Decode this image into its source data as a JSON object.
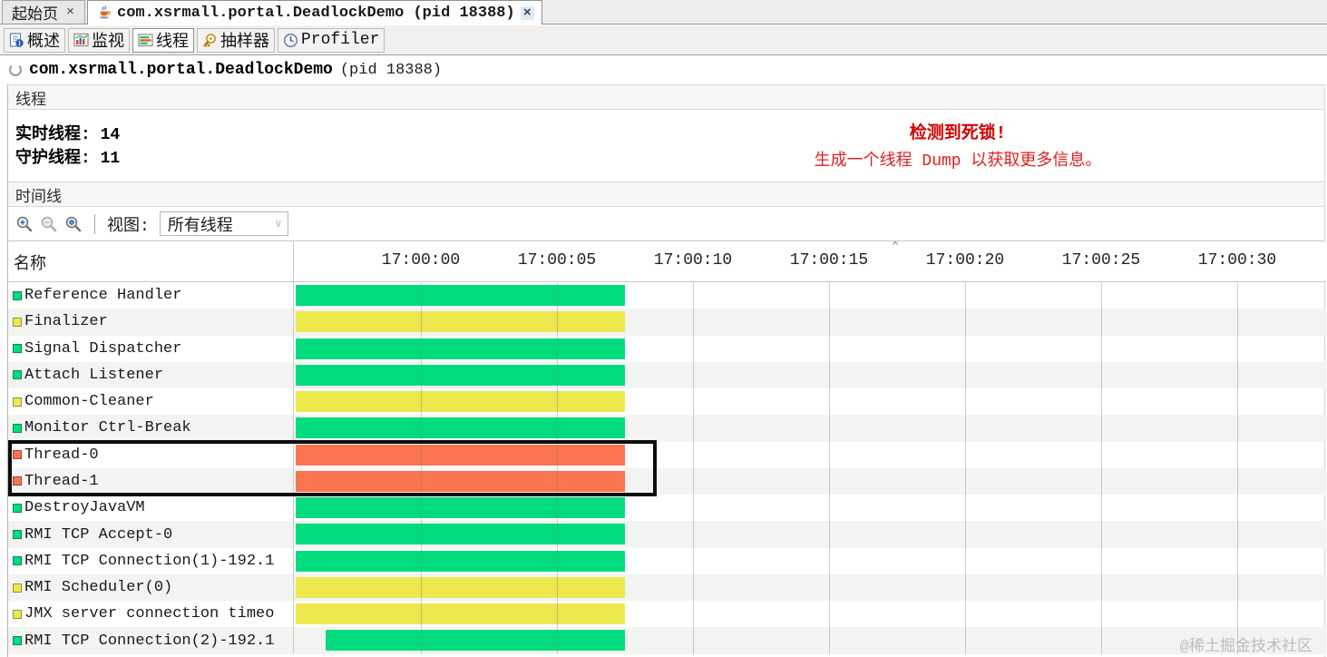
{
  "window": {
    "tabs": [
      {
        "label": "起始页",
        "icon": null,
        "active": false
      },
      {
        "label": "com.xsrmall.portal.DeadlockDemo (pid 18388)",
        "icon": "java-cup-icon",
        "active": true
      }
    ],
    "close_glyph": "×"
  },
  "toolbar": {
    "buttons": [
      {
        "label": "概述",
        "icon": "overview-icon",
        "selected": false
      },
      {
        "label": "监视",
        "icon": "monitor-icon",
        "selected": false
      },
      {
        "label": "线程",
        "icon": "threads-icon",
        "selected": true
      },
      {
        "label": "抽样器",
        "icon": "sampler-icon",
        "selected": false
      },
      {
        "label": "Profiler",
        "icon": "profiler-icon",
        "selected": false
      }
    ]
  },
  "header": {
    "app_name": "com.xsrmall.portal.DeadlockDemo",
    "pid": "(pid 18388)"
  },
  "threads_section": {
    "title": "线程",
    "live_label": "实时线程:",
    "live_value": "14",
    "daemon_label": "守护线程:",
    "daemon_value": "11",
    "deadlock_title": "检测到死锁!",
    "deadlock_message": "生成一个线程 Dump 以获取更多信息。"
  },
  "timeline_section": {
    "title": "时间线",
    "view_label": "视图:",
    "view_value": "所有线程",
    "name_column_header": "名称",
    "chevron": "∨"
  },
  "chart_data": {
    "type": "timeline",
    "x_axis": {
      "ticks": [
        "17:00:00",
        "17:00:05",
        "17:00:10",
        "17:00:15",
        "17:00:20",
        "17:00:25",
        "17:00:30"
      ],
      "tick_interval_seconds": 5
    },
    "state_colors": {
      "green": "#00DC7D",
      "yellow": "#EDE84E",
      "orange": "#FA7450"
    },
    "rows": [
      {
        "name": "Reference Handler",
        "state": "green",
        "start_s": -4.6,
        "end_s": 7.5,
        "highlighted": false
      },
      {
        "name": "Finalizer",
        "state": "yellow",
        "start_s": -4.6,
        "end_s": 7.5,
        "highlighted": false
      },
      {
        "name": "Signal Dispatcher",
        "state": "green",
        "start_s": -4.6,
        "end_s": 7.5,
        "highlighted": false
      },
      {
        "name": "Attach Listener",
        "state": "green",
        "start_s": -4.6,
        "end_s": 7.5,
        "highlighted": false
      },
      {
        "name": "Common-Cleaner",
        "state": "yellow",
        "start_s": -4.6,
        "end_s": 7.5,
        "highlighted": false
      },
      {
        "name": "Monitor Ctrl-Break",
        "state": "green",
        "start_s": -4.6,
        "end_s": 7.5,
        "highlighted": false
      },
      {
        "name": "Thread-0",
        "state": "orange",
        "start_s": -4.6,
        "end_s": 7.5,
        "highlighted": true
      },
      {
        "name": "Thread-1",
        "state": "orange",
        "start_s": -4.6,
        "end_s": 7.5,
        "highlighted": true
      },
      {
        "name": "DestroyJavaVM",
        "state": "green",
        "start_s": -4.6,
        "end_s": 7.5,
        "highlighted": false
      },
      {
        "name": "RMI TCP Accept-0",
        "state": "green",
        "start_s": -4.6,
        "end_s": 7.5,
        "highlighted": false
      },
      {
        "name": "RMI TCP Connection(1)-192.1",
        "state": "green",
        "start_s": -4.6,
        "end_s": 7.5,
        "highlighted": false
      },
      {
        "name": "RMI Scheduler(0)",
        "state": "yellow",
        "start_s": -4.6,
        "end_s": 7.5,
        "highlighted": false
      },
      {
        "name": "JMX server connection timeo",
        "state": "yellow",
        "start_s": -4.6,
        "end_s": 7.5,
        "highlighted": false
      },
      {
        "name": "RMI TCP Connection(2)-192.1",
        "state": "green",
        "start_s": -3.5,
        "end_s": 7.5,
        "highlighted": false
      }
    ]
  },
  "watermark": "@稀土掘金技术社区"
}
